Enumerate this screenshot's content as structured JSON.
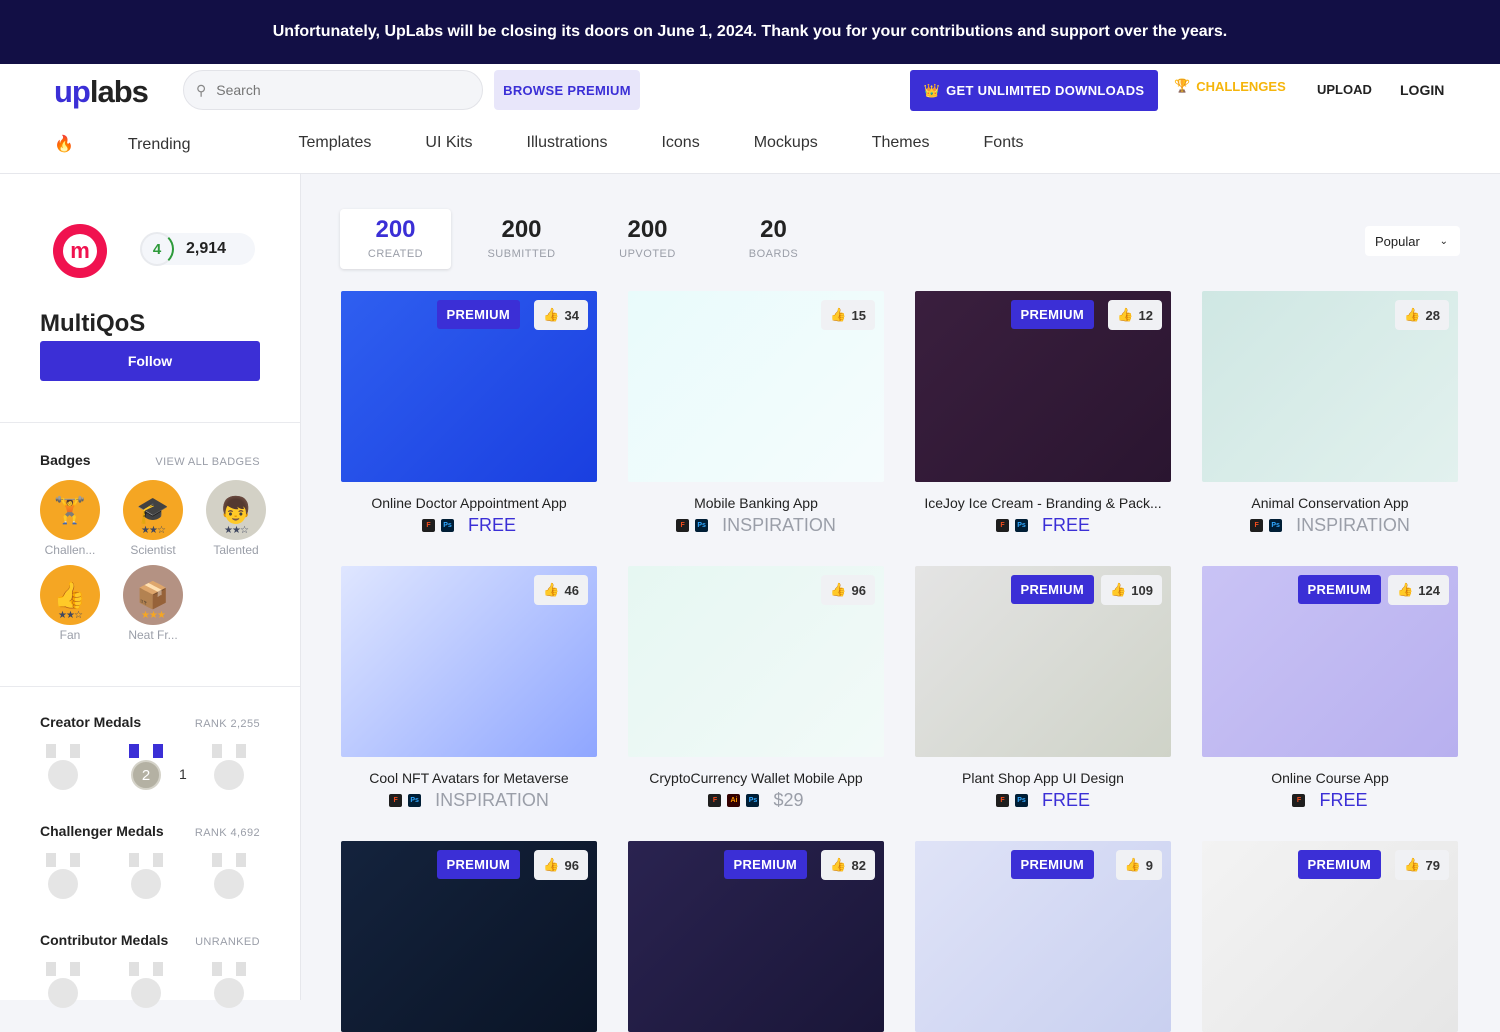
{
  "banner": "Unfortunately, UpLabs will be closing its doors on June 1, 2024. Thank you for your contributions and support over the years.",
  "header": {
    "logo_up": "up",
    "logo_labs": "labs",
    "search_placeholder": "Search",
    "browse_premium": "BROWSE PREMIUM",
    "get_unlimited": "GET UNLIMITED DOWNLOADS",
    "challenges": "CHALLENGES",
    "upload": "UPLOAD",
    "login": "LOGIN"
  },
  "nav": [
    "Trending",
    "Templates",
    "UI Kits",
    "Illustrations",
    "Icons",
    "Mockups",
    "Themes",
    "Fonts"
  ],
  "profile": {
    "avatar_letter": "m",
    "level": "4",
    "points": "2,914",
    "name": "MultiQoS",
    "follow": "Follow"
  },
  "badges": {
    "title": "Badges",
    "view_all": "VIEW ALL BADGES",
    "items": [
      {
        "label": "Challen...",
        "icon": "🏋️",
        "color": "#f5a623",
        "stars": 0
      },
      {
        "label": "Scientist",
        "icon": "🎓",
        "color": "#f5a623",
        "stars": 2
      },
      {
        "label": "Talented",
        "icon": "👦",
        "color": "#d3d1c6",
        "stars": 2
      },
      {
        "label": "Fan",
        "icon": "👍",
        "color": "#f5a623",
        "stars": 2
      },
      {
        "label": "Neat Fr...",
        "icon": "📦",
        "color": "#b49283",
        "stars": 3
      }
    ]
  },
  "medal_groups": [
    {
      "title": "Creator Medals",
      "rank": "RANK 2,255",
      "medals": [
        {
          "on": false
        },
        {
          "on": true,
          "num": "2",
          "count": "1"
        },
        {
          "on": false
        }
      ]
    },
    {
      "title": "Challenger Medals",
      "rank": "RANK 4,692",
      "medals": [
        {
          "on": false
        },
        {
          "on": false
        },
        {
          "on": false
        }
      ]
    },
    {
      "title": "Contributor Medals",
      "rank": "UNRANKED",
      "medals": [
        {
          "on": false
        },
        {
          "on": false
        },
        {
          "on": false
        }
      ]
    }
  ],
  "stats": [
    {
      "n": "200",
      "t": "CREATED",
      "active": true
    },
    {
      "n": "200",
      "t": "SUBMITTED"
    },
    {
      "n": "200",
      "t": "UPVOTED"
    },
    {
      "n": "20",
      "t": "BOARDS"
    }
  ],
  "sort": "Popular",
  "premium_label": "PREMIUM",
  "colors": {
    "accent": "#3b2fd6",
    "banner": "#120f45",
    "challenges": "#f5b50c",
    "inspiration": "#9a9ea8"
  },
  "cards": [
    {
      "title": "Online Doctor Appointment App",
      "premium": true,
      "likes": "34",
      "tools": [
        "figma",
        "ps"
      ],
      "price": "FREE",
      "bg": "linear-gradient(135deg,#2f5ff0,#1a3fe0)"
    },
    {
      "title": "Mobile Banking App",
      "premium": false,
      "likes": "15",
      "tools": [
        "figma",
        "ps"
      ],
      "price": "INSPIRATION",
      "bg": "linear-gradient(135deg,#e9fbfb,#f5fcfd)"
    },
    {
      "title": "IceJoy Ice Cream - Branding & Pack...",
      "premium": true,
      "likes": "12",
      "tools": [
        "figma",
        "ps"
      ],
      "price": "FREE",
      "bg": "linear-gradient(135deg,#3a1f3e,#2a1530)"
    },
    {
      "title": "Animal Conservation App",
      "premium": false,
      "likes": "28",
      "tools": [
        "figma",
        "ps"
      ],
      "price": "INSPIRATION",
      "bg": "linear-gradient(135deg,#cfe7e3,#e2f1ee)"
    },
    {
      "title": "Cool NFT Avatars for Metaverse",
      "premium": false,
      "likes": "46",
      "tools": [
        "figma",
        "ps"
      ],
      "price": "INSPIRATION",
      "bg": "linear-gradient(135deg,#dfe6ff,#8fa6ff)"
    },
    {
      "title": "CryptoCurrency Wallet Mobile App",
      "premium": false,
      "likes": "96",
      "tools": [
        "figma",
        "ai",
        "ps"
      ],
      "price": "$29",
      "bg": "linear-gradient(135deg,#e6f7f2,#f2faf8)"
    },
    {
      "title": "Plant Shop App UI Design",
      "premium": true,
      "likes": "109",
      "tools": [
        "figma",
        "ps"
      ],
      "price": "FREE",
      "bg": "linear-gradient(135deg,#e4e4e4,#cfd3c8)"
    },
    {
      "title": "Online Course App",
      "premium": true,
      "likes": "124",
      "tools": [
        "figma"
      ],
      "price": "FREE",
      "bg": "linear-gradient(135deg,#c9c3f5,#b8b0ef)"
    },
    {
      "title": "",
      "premium": true,
      "likes": "96",
      "tools": [],
      "price": "",
      "bg": "linear-gradient(135deg,#14233d,#0a1426)"
    },
    {
      "title": "",
      "premium": true,
      "likes": "82",
      "tools": [],
      "price": "",
      "bg": "linear-gradient(135deg,#2a2350,#1a1638)"
    },
    {
      "title": "",
      "premium": true,
      "likes": "9",
      "tools": [],
      "price": "",
      "bg": "linear-gradient(135deg,#dfe3f7,#c9d0f0)"
    },
    {
      "title": "",
      "premium": true,
      "likes": "79",
      "tools": [],
      "price": "",
      "bg": "linear-gradient(135deg,#f3f3f3,#e6e6e6)"
    }
  ]
}
